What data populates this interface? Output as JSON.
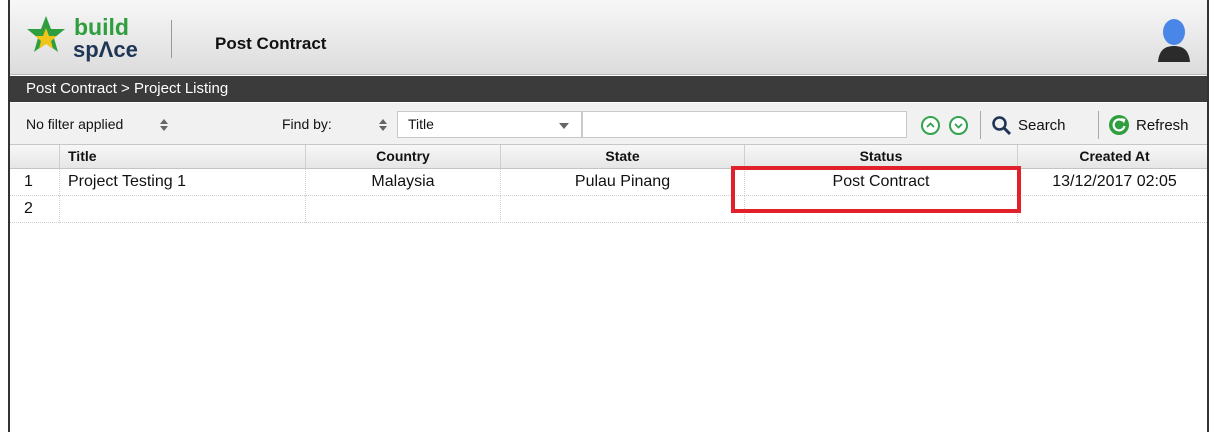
{
  "header": {
    "logo_text_top": "build",
    "logo_text_bottom": "spΛce",
    "app_title": "Post Contract"
  },
  "breadcrumb": "Post Contract > Project Listing",
  "toolbar": {
    "filter_label": "No filter applied",
    "find_by_label": "Find by:",
    "find_by_value": "Title",
    "search_value": "",
    "search_label": "Search",
    "refresh_label": "Refresh"
  },
  "grid": {
    "columns": [
      "Title",
      "Country",
      "State",
      "Status",
      "Created At"
    ],
    "rows": [
      {
        "num": "1",
        "title": "Project Testing 1",
        "country": "Malaysia",
        "state": "Pulau Pinang",
        "status": "Post Contract",
        "created_at": "13/12/2017 02:05"
      },
      {
        "num": "2",
        "title": "",
        "country": "",
        "state": "",
        "status": "",
        "created_at": ""
      }
    ]
  },
  "colors": {
    "brand_green": "#2f9e3f",
    "brand_navy": "#1f3556",
    "highlight_red": "#e0202a",
    "breadcrumb_bg": "#3b3b3b"
  },
  "icons": [
    "buildspace-logo",
    "user-avatar-icon",
    "sort-arrows-icon",
    "dropdown-caret-icon",
    "chevron-up-circle-icon",
    "chevron-down-circle-icon",
    "search-icon",
    "refresh-icon"
  ]
}
